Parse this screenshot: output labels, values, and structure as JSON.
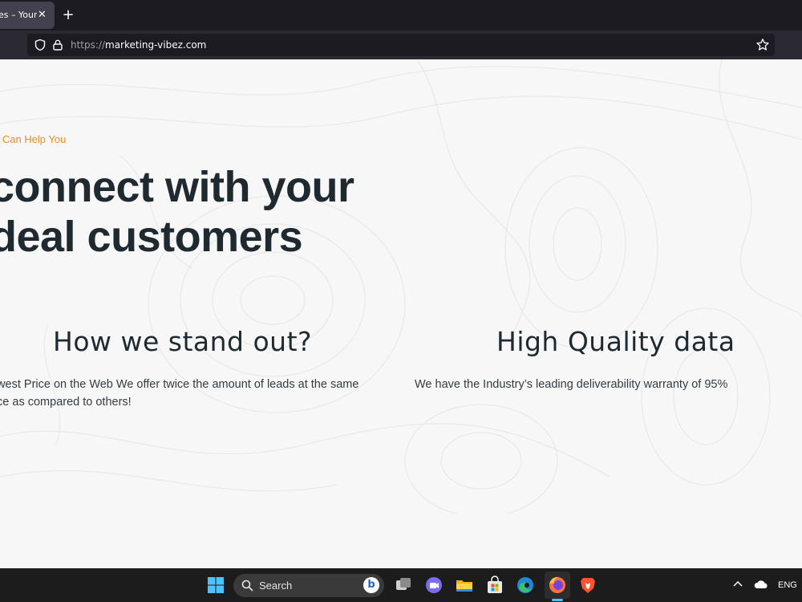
{
  "browser": {
    "tab_title": "es – Your",
    "tab_close": "✕",
    "new_tab": "+",
    "url_protocol": "https://",
    "url_host": "marketing-vibez.com"
  },
  "page": {
    "eyebrow": "e Can Help You",
    "headline_line1": "connect with your",
    "headline_line2": "deal customers",
    "features": [
      {
        "title": "How we stand out?",
        "text": "owest Price on the Web We offer twice the amount of leads at the same rice as compared to others!"
      },
      {
        "title": "High Quality data",
        "text": "We have the Industry’s leading deliverability warranty of 95%"
      }
    ],
    "colors": {
      "accent": "#ef8b1d",
      "heading": "#1f2a30"
    }
  },
  "taskbar": {
    "search_label": "Search",
    "bing_label": "b",
    "language": "ENG",
    "icons": [
      "windows-start-icon",
      "search-icon",
      "task-view-icon",
      "chat-icon",
      "file-explorer-icon",
      "store-icon",
      "edge-icon",
      "firefox-icon",
      "brave-icon",
      "chevron-up-icon",
      "onedrive-icon"
    ]
  }
}
